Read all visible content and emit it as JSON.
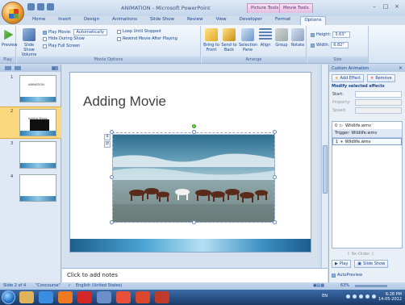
{
  "window": {
    "title": "ANIMATION - Microsoft PowerPoint",
    "context_tabs": [
      "Picture Tools",
      "Movie Tools"
    ]
  },
  "ribbon_tabs": [
    "Home",
    "Insert",
    "Design",
    "Animations",
    "Slide Show",
    "Review",
    "View",
    "Developer",
    "Format",
    "Options"
  ],
  "ribbon_active_tab": "Options",
  "ribbon": {
    "play_group": {
      "label": "Play",
      "preview": "Preview"
    },
    "movie_options": {
      "label": "Movie Options",
      "slide_show_volume": "Slide Show Volume",
      "play_movie_label": "Play Movie:",
      "play_movie_value": "Automatically",
      "hide_during_show": "Hide During Show",
      "play_full_screen": "Play Full Screen",
      "loop_until_stopped": "Loop Until Stopped",
      "rewind_after_playing": "Rewind Movie After Playing"
    },
    "arrange": {
      "label": "Arrange",
      "bring_to_front": "Bring to Front",
      "send_to_back": "Send to Back",
      "selection_pane": "Selection Pane",
      "align": "Align",
      "group": "Group",
      "rotate": "Rotate"
    },
    "size": {
      "label": "Size",
      "height_label": "Height:",
      "height_value": "3.63\"",
      "width_label": "Width:",
      "width_value": "6.82\""
    }
  },
  "slides_pane": {
    "slides": [
      {
        "number": "1",
        "title": "ANIMATION"
      },
      {
        "number": "2",
        "title": "Adding Movie"
      },
      {
        "number": "3",
        "title": ""
      },
      {
        "number": "4",
        "title": ""
      }
    ],
    "selected_index": 1
  },
  "slide": {
    "title": "Adding Movie",
    "trigger_marks": [
      "0",
      "⇄"
    ]
  },
  "notes": {
    "placeholder": "Click to add notes"
  },
  "custom_animation": {
    "title": "Custom Animation",
    "add_effect": "Add Effect",
    "remove": "Remove",
    "modify_header": "Modify selected effects",
    "start_label": "Start:",
    "property_label": "Property:",
    "speed_label": "Speed:",
    "list_items": [
      {
        "index": "0",
        "name": "Wildlife.wmv"
      }
    ],
    "trigger_label": "Trigger: Wildlife.wmv",
    "trigger_items": [
      {
        "index": "1",
        "name": "Wildlife.wmv"
      }
    ],
    "re_order": "Re-Order",
    "play": "Play",
    "slide_show": "Slide Show",
    "autopreview": "AutoPreview"
  },
  "status_bar": {
    "slide_info": "Slide 2 of 4",
    "theme": "\"Concourse\"",
    "language": "English (United States)",
    "zoom": "63%"
  },
  "taskbar": {
    "language": "EN",
    "time": "6:28 PM",
    "date": "14-05-2012"
  },
  "colors": {
    "ribbon_bg": "#dfe9f5",
    "selected_slide": "#fbd77d",
    "taskbar": "#2b5797"
  }
}
